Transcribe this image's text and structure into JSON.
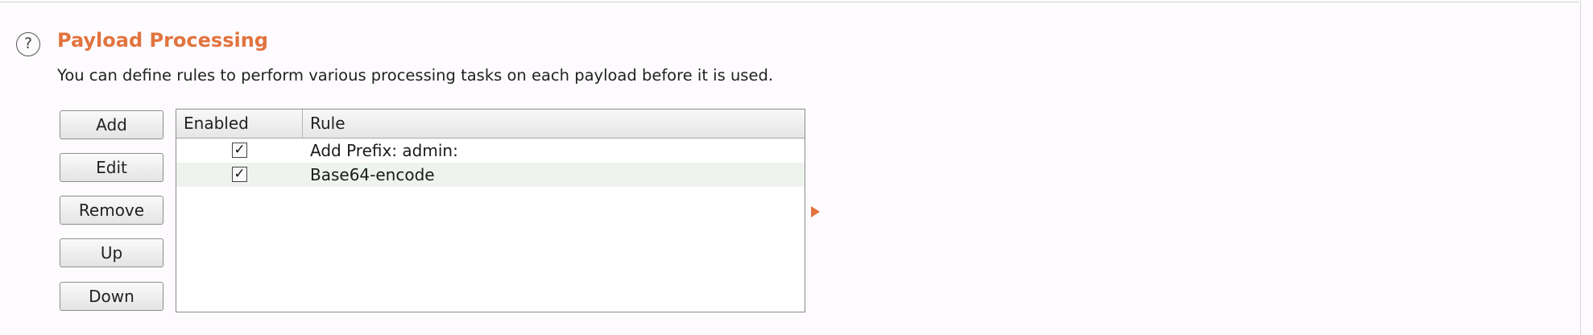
{
  "section": {
    "title": "Payload Processing",
    "description": "You can define rules to perform various processing tasks on each payload before it is used.",
    "help_icon": "question-circle-icon",
    "help_glyph": "?"
  },
  "buttons": {
    "add": "Add",
    "edit": "Edit",
    "remove": "Remove",
    "up": "Up",
    "down": "Down"
  },
  "table": {
    "columns": {
      "enabled": "Enabled",
      "rule": "Rule"
    },
    "rows": [
      {
        "enabled": true,
        "check": "✓",
        "rule": "Add Prefix: admin:"
      },
      {
        "enabled": true,
        "check": "✓",
        "rule": "Base64-encode"
      }
    ]
  },
  "colors": {
    "accent": "#e2733f"
  }
}
